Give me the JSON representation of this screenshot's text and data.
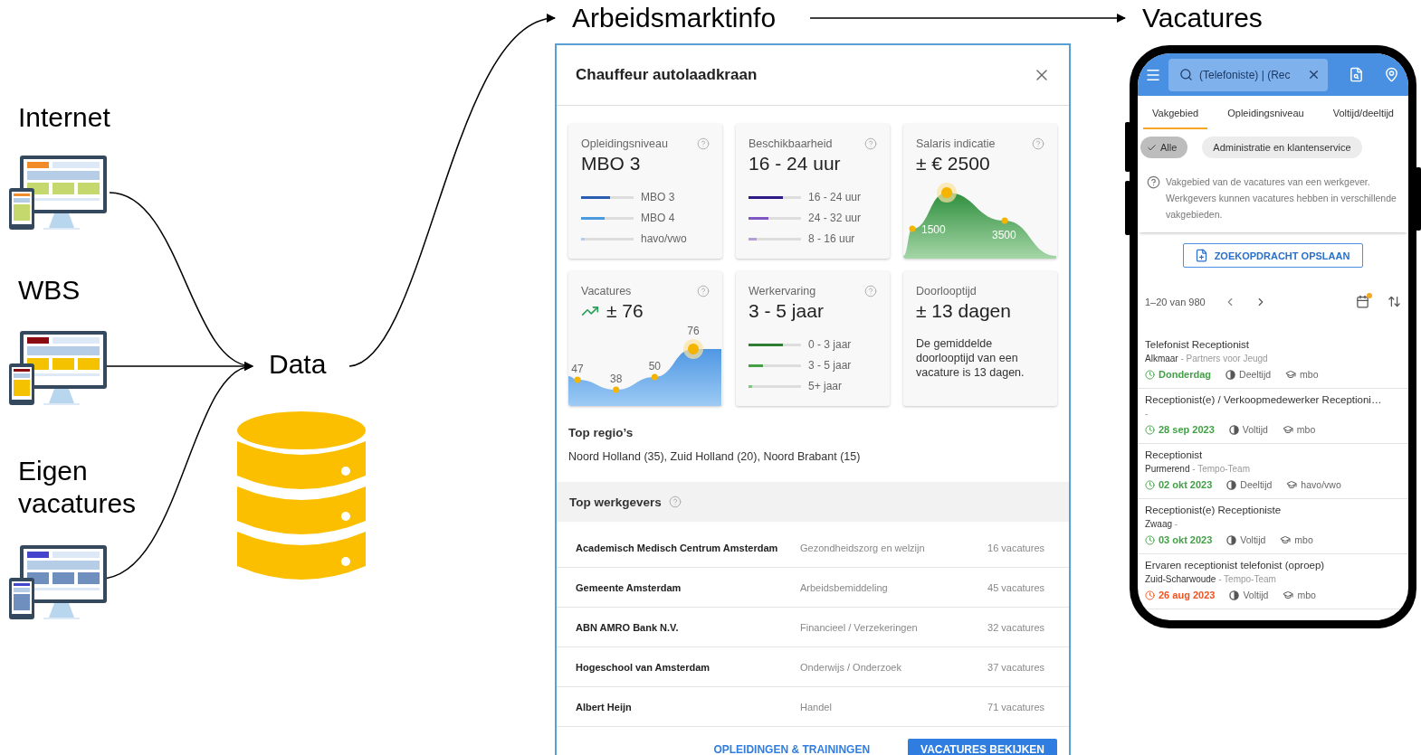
{
  "sources": [
    {
      "label": "Internet",
      "color": "#f28c28"
    },
    {
      "label": "WBS",
      "color": "#8b0a12"
    },
    {
      "label": "Eigen vacatures",
      "color": "#4444cc"
    }
  ],
  "hub": {
    "label": "Data"
  },
  "targets": {
    "market_title": "Arbeidsmarktinfo",
    "vacancies_title": "Vacatures"
  },
  "modal": {
    "title": "Chauffeur autolaadkraan",
    "cards": [
      {
        "kind": "bars",
        "label": "Opleidingsniveau",
        "value": "MBO 3",
        "help": true,
        "bars": [
          {
            "label": "MBO 3",
            "level": 0.55,
            "color": "#2a5db0"
          },
          {
            "label": "MBO 4",
            "level": 0.45,
            "color": "#4a9ae0"
          },
          {
            "label": "havo/vwo",
            "level": 0.07,
            "color": "#b3cdf0"
          }
        ]
      },
      {
        "kind": "bars",
        "label": "Beschikbaarheid",
        "value": "16 - 24 uur",
        "help": true,
        "bars": [
          {
            "label": "16 - 24 uur",
            "level": 0.65,
            "color": "#2e1a87"
          },
          {
            "label": "24 - 32 uur",
            "level": 0.38,
            "color": "#7e57c2"
          },
          {
            "label": "8 - 16 uur",
            "level": 0.15,
            "color": "#b39ddb"
          }
        ]
      },
      {
        "kind": "salary",
        "label": "Salaris indicatie",
        "value": "± € 2500",
        "help": true,
        "labels": [
          "1500",
          "3500"
        ]
      },
      {
        "kind": "trend",
        "label": "Vacatures",
        "value": "± 76",
        "help": true,
        "point_labels": [
          "47",
          "38",
          "50",
          "76"
        ]
      },
      {
        "kind": "bars",
        "label": "Werkervaring",
        "value": "3 - 5 jaar",
        "help": true,
        "bars": [
          {
            "label": "0 - 3 jaar",
            "level": 0.65,
            "color": "#2e7d32"
          },
          {
            "label": "3 - 5 jaar",
            "level": 0.28,
            "color": "#43a047"
          },
          {
            "label": "5+ jaar",
            "level": 0.07,
            "color": "#81c784"
          }
        ]
      },
      {
        "kind": "text",
        "label": "Doorlooptijd",
        "value": "± 13 dagen",
        "help": false,
        "note": "De gemiddelde doorlooptijd van een vacature is 13 dagen."
      }
    ],
    "regions": {
      "title": "Top regio’s",
      "text": "Noord Holland (35), Zuid Holland (20), Noord Brabant (15)"
    },
    "employers": {
      "title": "Top werkgevers",
      "rows": [
        {
          "name": "Academisch Medisch Centrum Amsterdam",
          "sector": "Gezondheidszorg en welzijn",
          "count": "16 vacatures"
        },
        {
          "name": "Gemeente Amsterdam",
          "sector": "Arbeidsbemiddeling",
          "count": "45 vacatures"
        },
        {
          "name": "ABN AMRO Bank N.V.",
          "sector": "Financieel / Verzekeringen",
          "count": "32 vacatures"
        },
        {
          "name": "Hogeschool van Amsterdam",
          "sector": "Onderwijs / Onderzoek",
          "count": "37 vacatures"
        },
        {
          "name": "Albert Heijn",
          "sector": "Handel",
          "count": "71 vacatures"
        }
      ]
    },
    "actions": [
      {
        "label": "OPLEIDINGEN & TRAININGEN",
        "kind": "text"
      },
      {
        "label": "VACATURES BEKIJKEN",
        "kind": "primary"
      }
    ]
  },
  "phone": {
    "search": {
      "value": "(Telefoniste) | (Rec"
    },
    "tabs": [
      {
        "label": "Vakgebied",
        "selected": true
      },
      {
        "label": "Opleidingsniveau",
        "selected": false
      },
      {
        "label": "Voltijd/deeltijd",
        "selected": false
      }
    ],
    "chips": [
      {
        "label": "Alle",
        "selected": true
      },
      {
        "label": "Administratie en klantenservice",
        "selected": false
      }
    ],
    "info": "Vakgebied van de vacatures van een werkgever. Werkgevers kunnen vacatures hebben in verschillende vakgebieden.",
    "save_label": "ZOEKOPDRACHT OPSLAAN",
    "range": "1–20 van 980",
    "jobs": [
      {
        "title": "Telefonist Receptionist",
        "city": "Alkmaar",
        "company": "- Partners voor Jeugd",
        "date": "Donderdag",
        "color": "#43a047",
        "hours": "Deeltijd",
        "education": "mbo"
      },
      {
        "title": "Receptionist(e) / Verkoopmedewerker Receptioni…",
        "company": "-",
        "date": "28 sep 2023",
        "color": "#43a047",
        "hours": "Voltijd",
        "education": "mbo"
      },
      {
        "title": "Receptionist",
        "city": "Purmerend",
        "company": "- Tempo-Team",
        "date": "02 okt 2023",
        "color": "#43a047",
        "hours": "Deeltijd",
        "education": "havo/vwo"
      },
      {
        "title": "Receptionist(e) Receptioniste",
        "city": "Zwaag",
        "company": "-",
        "date": "03 okt 2023",
        "color": "#43a047",
        "hours": "Voltijd",
        "education": "mbo"
      },
      {
        "title": "Ervaren receptionist telefonist (oproep)",
        "city": "Zuid-Scharwoude",
        "company": "- Tempo-Team",
        "date": "26 aug 2023",
        "color": "#f4511e",
        "hours": "Voltijd",
        "education": "mbo"
      }
    ]
  }
}
